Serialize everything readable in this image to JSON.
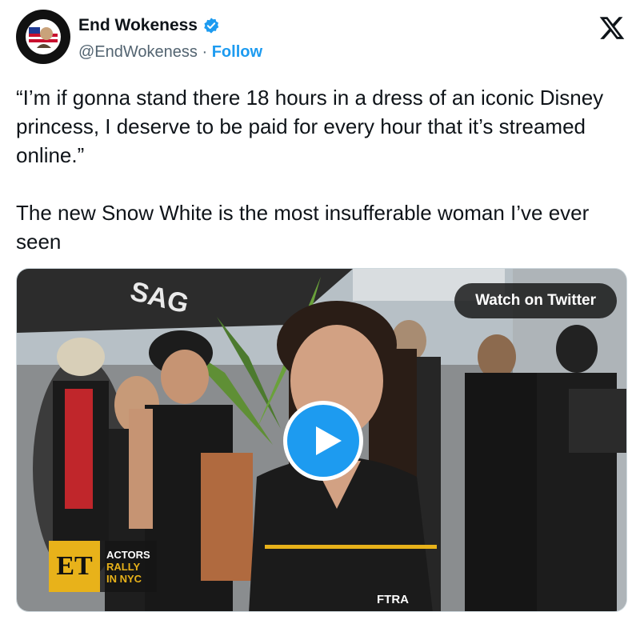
{
  "author": {
    "display_name": "End Wokeness",
    "handle": "@EndWokeness",
    "separator": "·",
    "follow_label": "Follow",
    "verified": true
  },
  "tweet": {
    "text": "“I’m if gonna stand there 18 hours in a dress of an iconic Disney princess, I deserve to be paid for every hour that it’s streamed online.”\n\nThe new Snow White is the most insufferable woman I’ve ever seen"
  },
  "media": {
    "watch_label": "Watch on Twitter",
    "overlay": {
      "logo_text": "ET",
      "line1": "ACTORS",
      "line2": "RALLY",
      "line3": "IN NYC"
    }
  },
  "colors": {
    "accent": "#1d9bf0",
    "text": "#0f1419",
    "muted": "#536471",
    "et_gold": "#e8b21a"
  },
  "icons": [
    "verified-badge-icon",
    "x-logo-icon",
    "play-icon",
    "avatar-badge"
  ]
}
